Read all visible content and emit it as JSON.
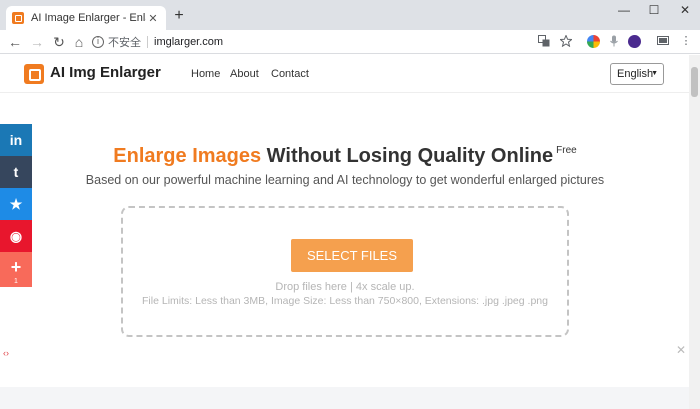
{
  "browser": {
    "tab_title": "AI Image Enlarger - Enlarge Im",
    "tab_close": "✕",
    "new_tab": "+",
    "window": {
      "minimize": "—",
      "maximize": "☐",
      "close": "✕"
    },
    "nav": {
      "back": "←",
      "forward": "→",
      "reload": "↻",
      "home": "⌂"
    },
    "info_icon": "i",
    "security_label": "不安全",
    "url": "imglarger.com",
    "menu": "⋮"
  },
  "site": {
    "logo_text": "AI Img Enlarger",
    "nav": [
      "Home",
      "About",
      "Contact"
    ],
    "language": "English",
    "language_caret": "▼"
  },
  "share_bar": [
    {
      "icon": "linkedin-icon",
      "glyph": "in",
      "color": "#1b78b5"
    },
    {
      "icon": "tumblr-icon",
      "glyph": "t",
      "color": "#36465d"
    },
    {
      "icon": "star-bookmark-icon",
      "glyph": "★",
      "color": "#1e8be6"
    },
    {
      "icon": "weibo-icon",
      "glyph": "◉",
      "color": "#e8162d"
    },
    {
      "icon": "plus-share-icon",
      "glyph": "+",
      "color": "#f86a5a",
      "count": "1"
    }
  ],
  "hero": {
    "title_accent": "Enlarge Images",
    "title_rest": " Without Losing Quality Online",
    "title_badge": "Free",
    "subtitle": "Based on our powerful machine learning and AI technology to get wonderful enlarged pictures"
  },
  "upload": {
    "button_label": "SELECT FILES",
    "drop_hint": "Drop files here | 4x scale up.",
    "limits": "File Limits: Less than 3MB, Image Size: Less than 750×800, Extensions: .jpg .jpeg .png"
  },
  "misc": {
    "arrows": "‹›",
    "close": "✕"
  },
  "colors": {
    "accent": "#f07b20",
    "button": "#f5a04e"
  }
}
